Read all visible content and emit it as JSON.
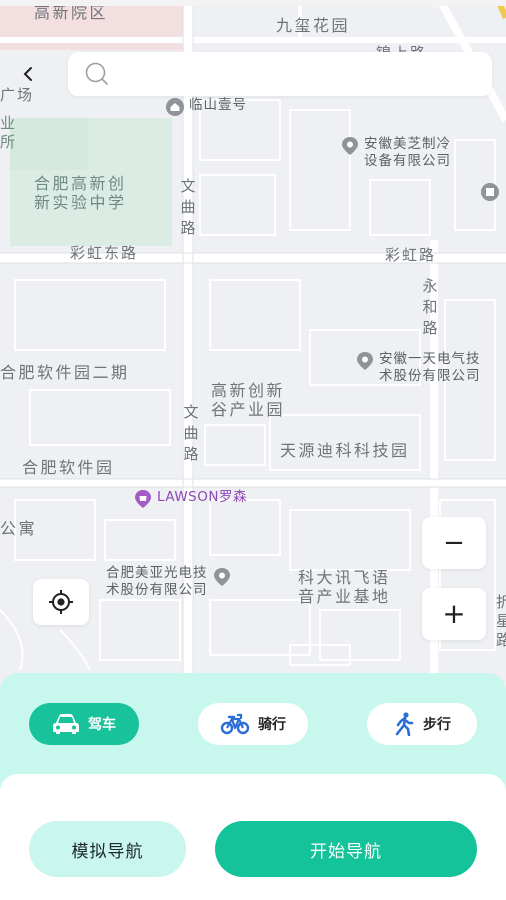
{
  "map": {
    "areas": {
      "top_left": "高新院区",
      "top_center": "九玺花园",
      "top_right_partial": "锦上路",
      "left_partial_1": "广场",
      "left_partial_2": "业\n所",
      "school": "合肥高新创\n新实验中学",
      "software_park_2": "合肥软件园二期",
      "innovation_park": "高新创新\n谷产业园",
      "tianyuan": "天源迪科科技园",
      "software_park": "合肥软件园",
      "apartment_partial": "公寓",
      "iflytek": "科大讯飞语\n音产业基地",
      "right_partial": "折\n星\n路"
    },
    "roads": {
      "caihong_east": "彩虹东路",
      "caihong": "彩虹路",
      "wenqu_upper": "文曲路",
      "wenqu_lower": "文曲路",
      "yonghe": "永和路"
    },
    "pois": {
      "linshan": "临山壹号",
      "meizhi": "安徽美芝制冷\n设备有限公司",
      "yitian": "安徽一天电气技\n术股份有限公司",
      "lawson": "LAWSON罗森",
      "meiya": "合肥美亚光电技\n术股份有限公司"
    }
  },
  "search": {
    "placeholder": "",
    "value": ""
  },
  "controls": {
    "zoom_out_symbol": "−",
    "zoom_in_symbol": "+"
  },
  "modes": [
    {
      "label": "驾车",
      "icon": "car-icon",
      "active": true
    },
    {
      "label": "骑行",
      "icon": "bicycle-icon",
      "active": false
    },
    {
      "label": "步行",
      "icon": "walking-person-icon",
      "active": false
    }
  ],
  "actions": {
    "simulate_label": "模拟导航",
    "start_label": "开始导航"
  },
  "colors": {
    "accent": "#15c39a",
    "panel_mint": "#c8f7ee",
    "lawson_purple": "#8e4ab3"
  }
}
